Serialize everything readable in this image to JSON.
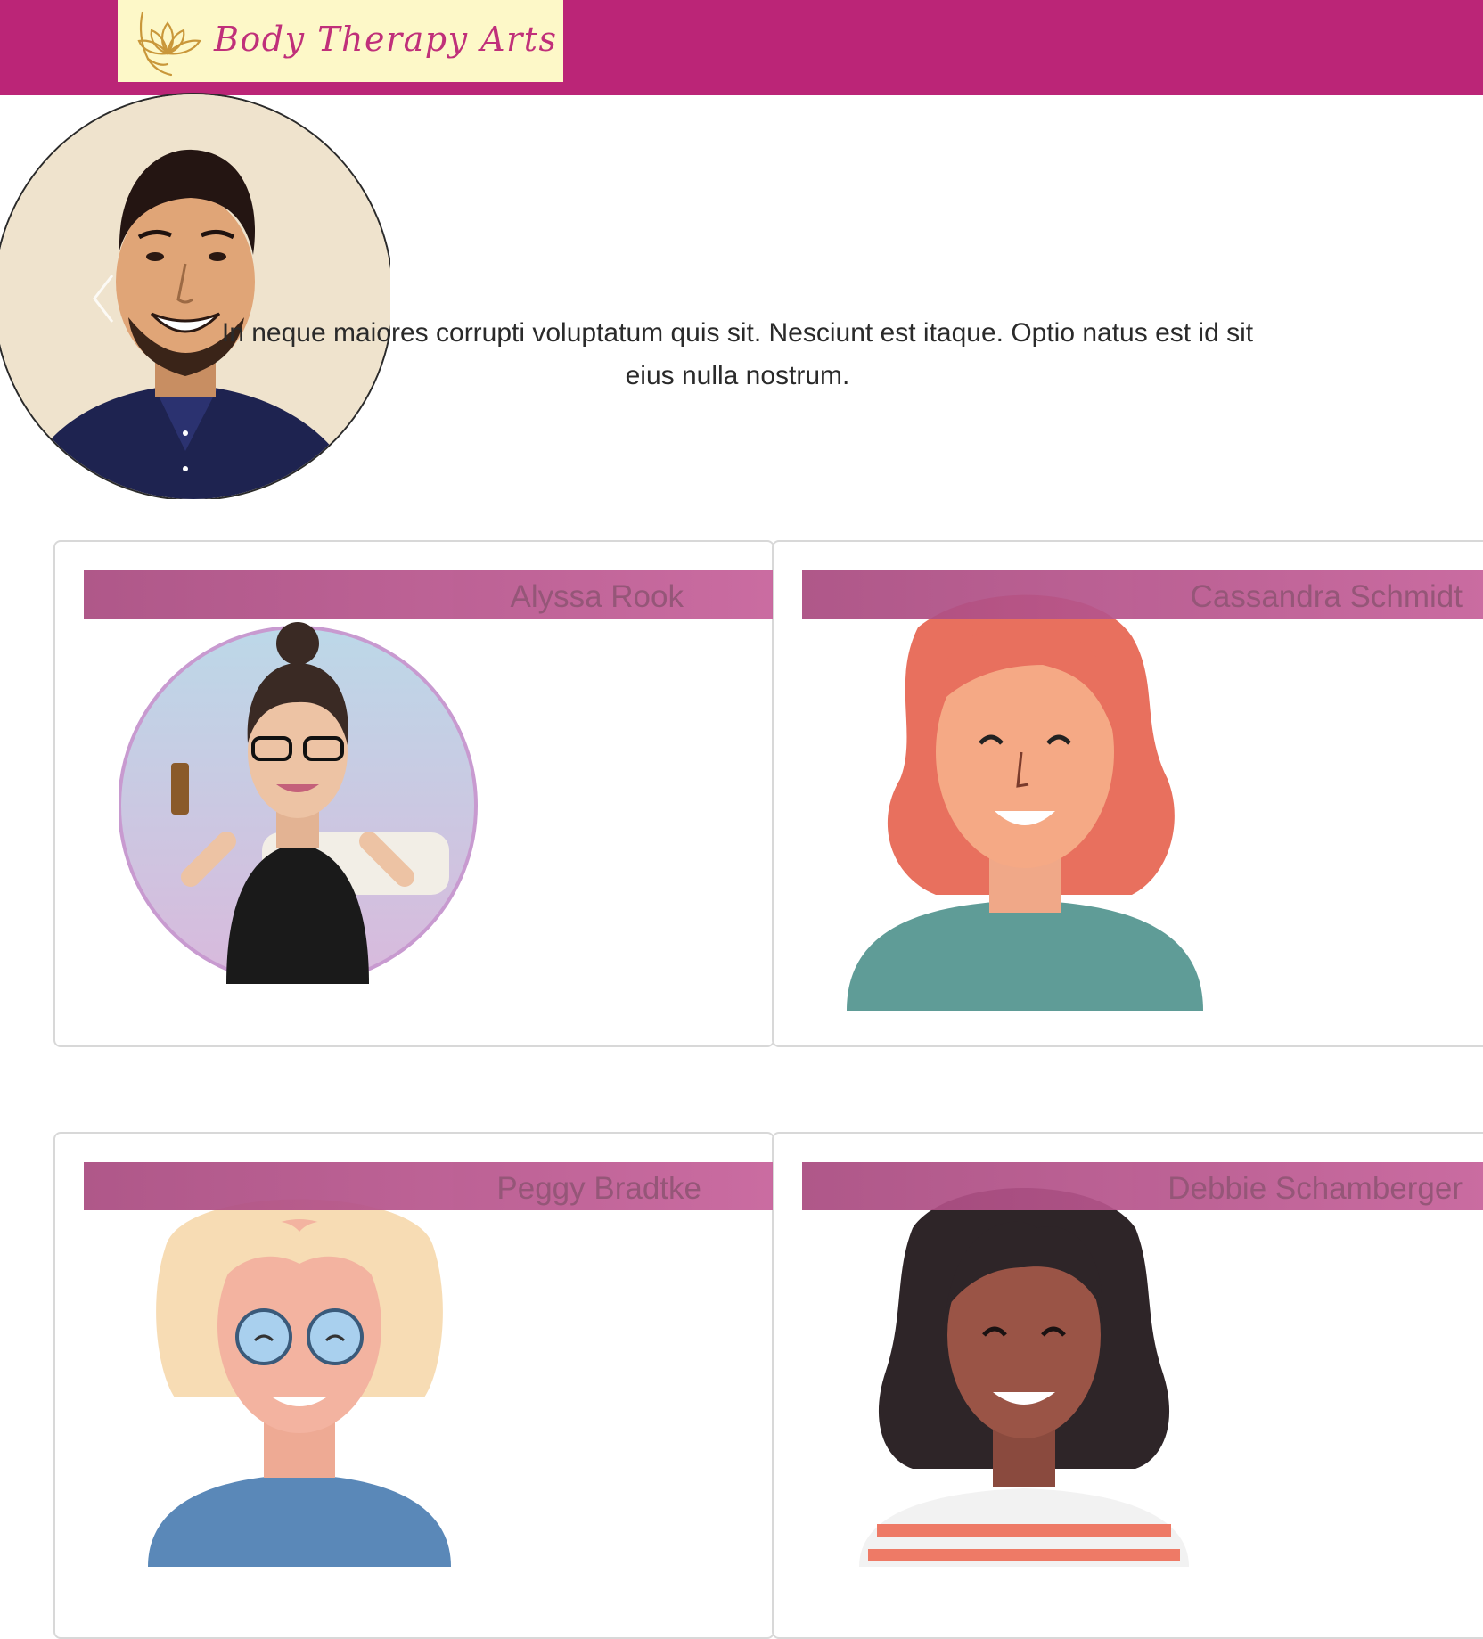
{
  "header": {
    "logo_text": "Body Therapy Arts",
    "logo_icon": "lotus-icon",
    "brand_color": "#bb2577",
    "logo_background": "#fdf8c8"
  },
  "hero": {
    "text": "In neque maiores corrupti voluptatum quis sit. Nesciunt est itaque. Optio natus est id sit eius nulla nostrum.",
    "prev_icon": "chevron-left-icon"
  },
  "therapists": [
    {
      "name": "Alyssa Rook"
    },
    {
      "name": "Cassandra Schmidt"
    },
    {
      "name": "Peggy Bradtke"
    },
    {
      "name": "Debbie Schamberger"
    }
  ]
}
